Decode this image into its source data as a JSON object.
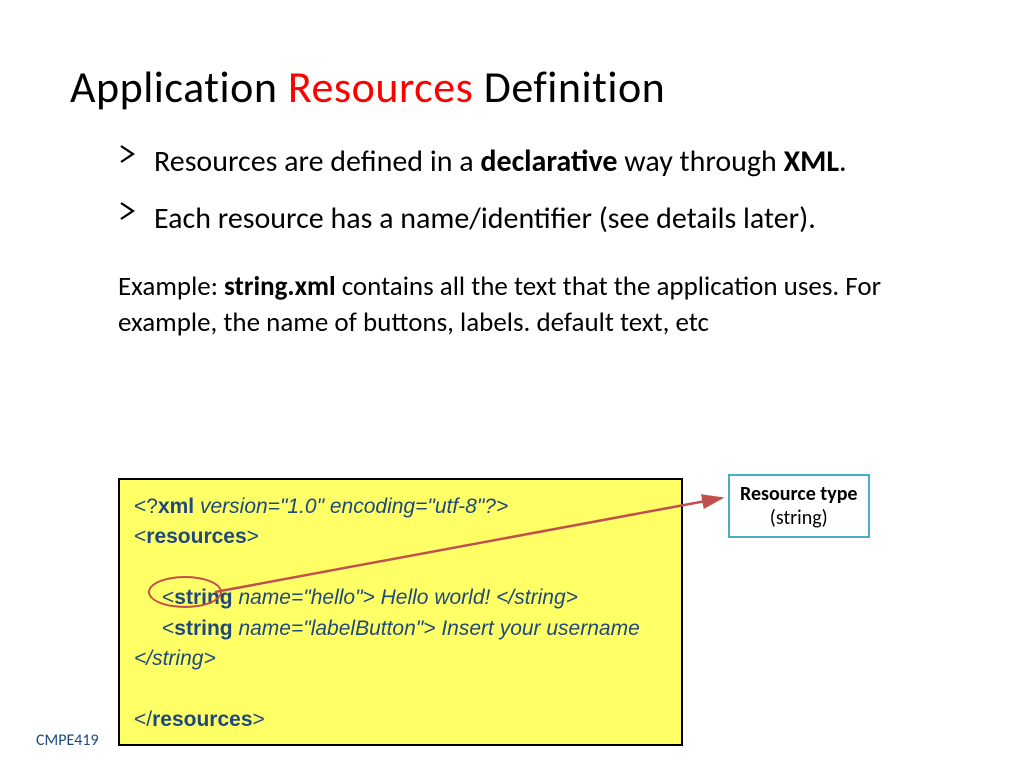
{
  "title": {
    "pre": "Application ",
    "hl": "Resources",
    "post": " Definition"
  },
  "bullets": [
    {
      "pre": "Resources are defined in a ",
      "b1": "declarative",
      "mid": " way through ",
      "b2": "XML",
      "post": "."
    },
    {
      "text": "Each resource has a name/identifier (see details later)."
    }
  ],
  "example": {
    "pre": "Example: ",
    "b": "string.xml",
    "post": " contains all the text that the application uses. For example, the name of buttons, labels. default text, etc"
  },
  "code": {
    "l1_open": "<?",
    "l1_kw": "xml",
    "l1_attr": " version=",
    "l1_val": "\"1.0\" encoding=\"utf-8\"?>",
    "l2_open": "<",
    "l2_kw": "resources",
    "l2_close": ">",
    "l3_open": "<",
    "l3_kw": "string",
    "l3_attr": " name=",
    "l3_val": "\"hello\"> Hello world! ",
    "l3_close": "</string>",
    "l4_open": "<",
    "l4_kw": "string",
    "l4_attr": " name=",
    "l4_val": "\"labelButton\"> Insert your username ",
    "l4_close": "</string>",
    "l5_open": "</",
    "l5_kw": "resources",
    "l5_close": ">"
  },
  "callout": {
    "title": "Resource type",
    "sub": "(string)"
  },
  "footer": "CMPE419"
}
